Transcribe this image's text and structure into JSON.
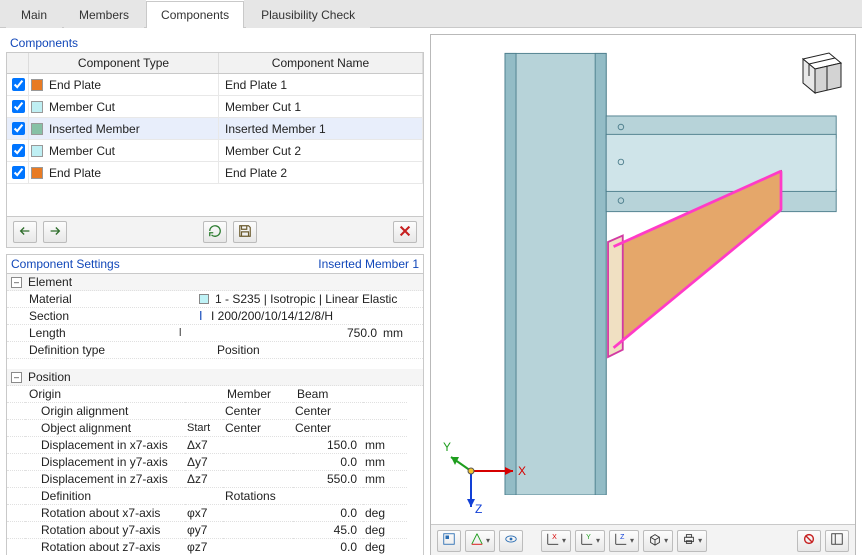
{
  "tabs": {
    "main": "Main",
    "members": "Members",
    "components": "Components",
    "plausibility": "Plausibility Check",
    "active_index": 2
  },
  "components_panel": {
    "title": "Components",
    "headers": {
      "type": "Component Type",
      "name": "Component Name"
    },
    "rows": [
      {
        "checked": true,
        "color": "#e87b24",
        "type": "End Plate",
        "name": "End Plate 1",
        "selected": false
      },
      {
        "checked": true,
        "color": "#bfeff3",
        "type": "Member Cut",
        "name": "Member Cut 1",
        "selected": false
      },
      {
        "checked": true,
        "color": "#86c1a6",
        "type": "Inserted Member",
        "name": "Inserted Member 1",
        "selected": true
      },
      {
        "checked": true,
        "color": "#bfeff3",
        "type": "Member Cut",
        "name": "Member Cut 2",
        "selected": false
      },
      {
        "checked": true,
        "color": "#e87b24",
        "type": "End Plate",
        "name": "End Plate 2",
        "selected": false
      }
    ]
  },
  "mini_toolbar_icons": {
    "move_up": "move-up-icon",
    "move_down": "move-down-icon",
    "refresh": "refresh-icon",
    "save": "save-icon",
    "delete": "delete-icon"
  },
  "settings_panel": {
    "title": "Component Settings",
    "subtitle": "Inserted Member 1",
    "element_group": {
      "label": "Element",
      "material": {
        "label": "Material",
        "color": "#bff2f6",
        "value": "1 - S235 | Isotropic | Linear Elastic"
      },
      "section": {
        "label": "Section",
        "icon": "I",
        "value": "I 200/200/10/14/12/8/H"
      },
      "length": {
        "label": "Length",
        "symbol": "l",
        "value": "750.0",
        "unit": "mm"
      },
      "deftype": {
        "label": "Definition type",
        "value": "Position"
      }
    },
    "position_group": {
      "label": "Position",
      "head": {
        "member": "Member",
        "beam": "Beam"
      },
      "origin": {
        "label": "Origin"
      },
      "origin_align": {
        "label": "Origin alignment",
        "member": "Center",
        "beam": "Center"
      },
      "object_align": {
        "label": "Object alignment",
        "v1": "Start",
        "member": "Center",
        "beam": "Center"
      },
      "dx": {
        "label": "Displacement in x7-axis",
        "symbol": "Δx7",
        "value": "150.0",
        "unit": "mm"
      },
      "dy": {
        "label": "Displacement in y7-axis",
        "symbol": "Δy7",
        "value": "0.0",
        "unit": "mm"
      },
      "dz": {
        "label": "Displacement in z7-axis",
        "symbol": "Δz7",
        "value": "550.0",
        "unit": "mm"
      },
      "definition": {
        "label": "Definition",
        "value": "Rotations"
      },
      "rx": {
        "label": "Rotation about x7-axis",
        "symbol": "φx7",
        "value": "0.0",
        "unit": "deg"
      },
      "ry": {
        "label": "Rotation about y7-axis",
        "symbol": "φy7",
        "value": "45.0",
        "unit": "deg"
      },
      "rz": {
        "label": "Rotation about z7-axis",
        "symbol": "φz7",
        "value": "0.0",
        "unit": "deg"
      }
    }
  },
  "viewport": {
    "axes": {
      "x": "X",
      "y": "Y",
      "z": "Z"
    }
  }
}
